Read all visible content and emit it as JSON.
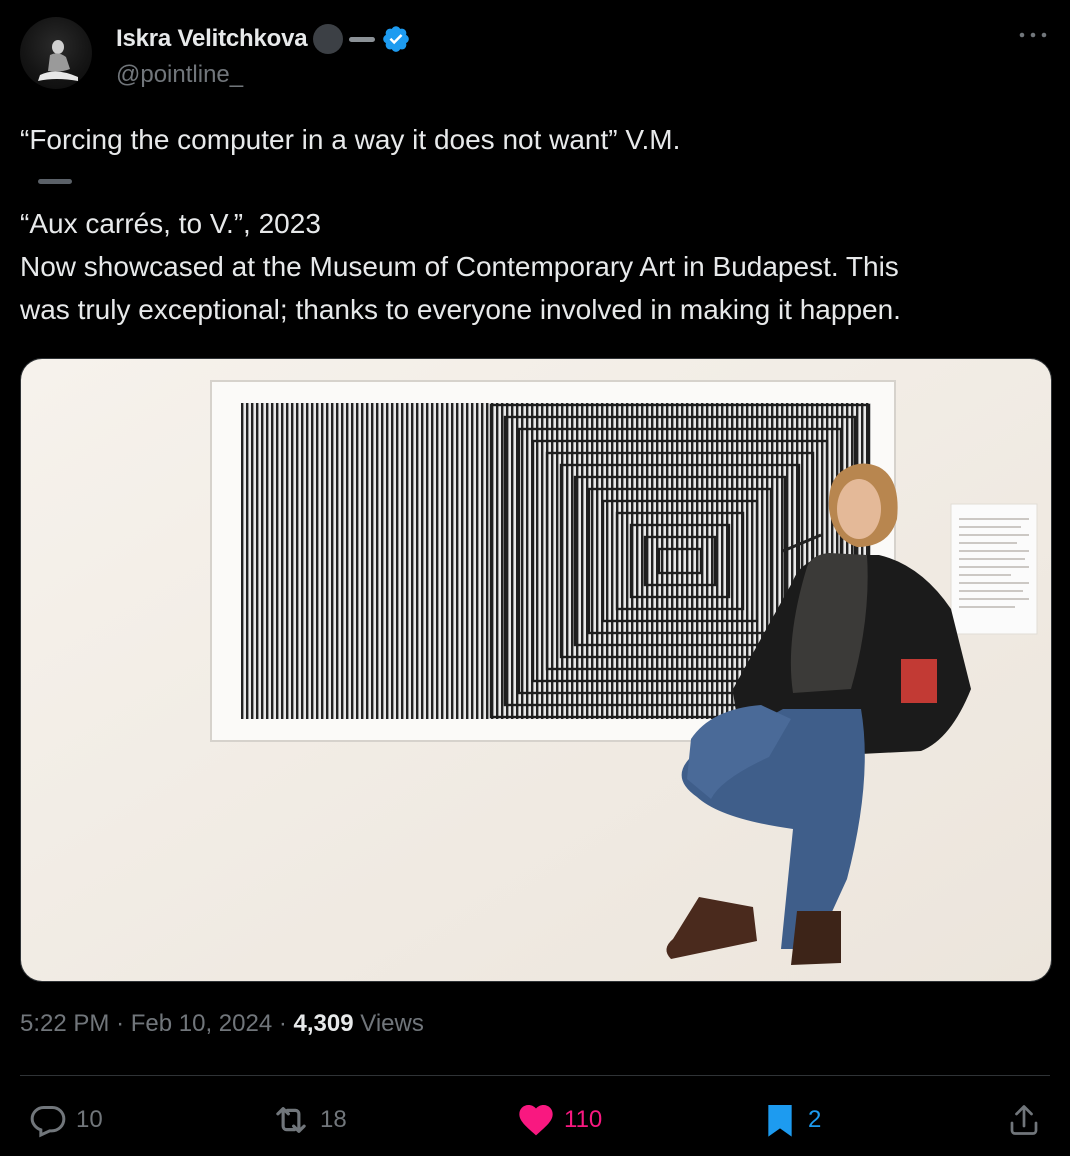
{
  "author": {
    "display_name": "Iskra Velitchkova",
    "handle": "@pointline_",
    "verified": true,
    "verified_color": "#1d9bf0"
  },
  "tweet": {
    "quote_line": "“Forcing the computer in a way it does not want” V.M.",
    "artwork_line": "“Aux carrés, to V.”, 2023",
    "body_line_1": "Now showcased at the Museum of Contemporary Art in Budapest. This",
    "body_line_2": "was truly exceptional; thanks to everyone involved in making it happen."
  },
  "meta": {
    "time": "5:22 PM",
    "date": "Feb 10, 2024",
    "views_count": "4,309",
    "views_label": "Views"
  },
  "actions": {
    "replies": "10",
    "reposts": "18",
    "likes": "110",
    "bookmarks": "2",
    "like_color": "#f91880",
    "bookmark_color": "#1d9bf0"
  },
  "icons": [
    "more-icon",
    "verified-icon",
    "reply-icon",
    "repost-icon",
    "like-icon",
    "bookmark-icon",
    "share-icon"
  ]
}
